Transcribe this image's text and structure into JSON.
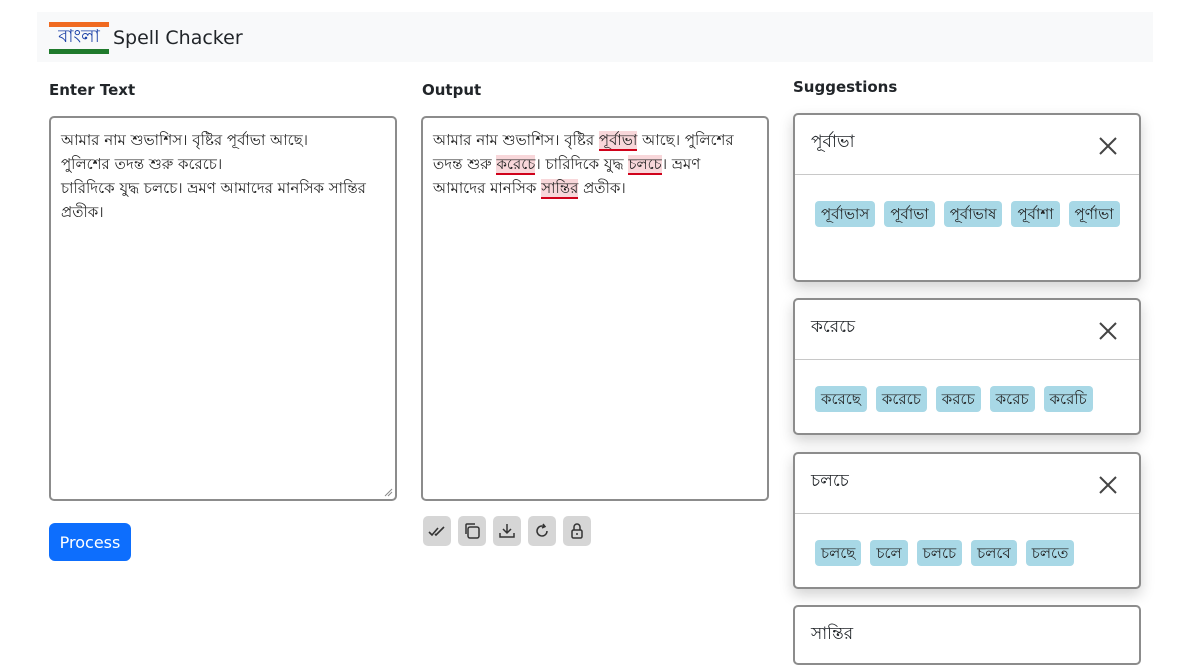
{
  "brand": {
    "logo_text": "বাংলা",
    "title": "Spell Chacker"
  },
  "input": {
    "label": "Enter Text",
    "lines": [
      "আমার নাম শুভাশিস। বৃষ্টির পূর্বাভা আছে।",
      "পুলিশের তদন্ত শুরু করেচে।",
      "চারিদিকে যুদ্ধ চলচে। ভ্রমণ আমাদের মানসিক সান্তির",
      "প্রতীক।"
    ],
    "process_label": "Process"
  },
  "output": {
    "label": "Output",
    "segments": [
      {
        "text": "আমার নাম শুভাশিস। বৃষ্টির ",
        "error": false
      },
      {
        "text": "পূর্বাভা",
        "error": true
      },
      {
        "text": " আছে। পুলিশের তদন্ত শুরু ",
        "error": false
      },
      {
        "text": "করেচে",
        "error": true
      },
      {
        "text": "। চারিদিকে যুদ্ধ ",
        "error": false
      },
      {
        "text": "চলচে",
        "error": true
      },
      {
        "text": "। ভ্রমণ আমাদের মানসিক ",
        "error": false
      },
      {
        "text": "সান্তির",
        "error": true
      },
      {
        "text": " প্রতীক।",
        "error": false
      }
    ],
    "tools": [
      "check-all-icon",
      "copy-icon",
      "download-icon",
      "refresh-icon",
      "lock-icon"
    ]
  },
  "suggestions": {
    "label": "Suggestions",
    "cards": [
      {
        "word": "পূর্বাভা",
        "options": [
          "পূর্বাভাস",
          "পূর্বাভা",
          "পূর্বাভাষ",
          "পূর্বাশা",
          "পূর্ণাভা"
        ]
      },
      {
        "word": "করেচে",
        "options": [
          "করেছে",
          "করেচে",
          "করচে",
          "করেচ",
          "করেচি"
        ]
      },
      {
        "word": "চলচে",
        "options": [
          "চলছে",
          "চলে",
          "চলচে",
          "চলবে",
          "চলতে"
        ]
      },
      {
        "word": "সান্তির",
        "options": []
      }
    ]
  },
  "colors": {
    "primary": "#0d6efd",
    "chip": "#a8d8e6",
    "error_bg": "#f8d7da",
    "error_line": "#d0021b"
  }
}
